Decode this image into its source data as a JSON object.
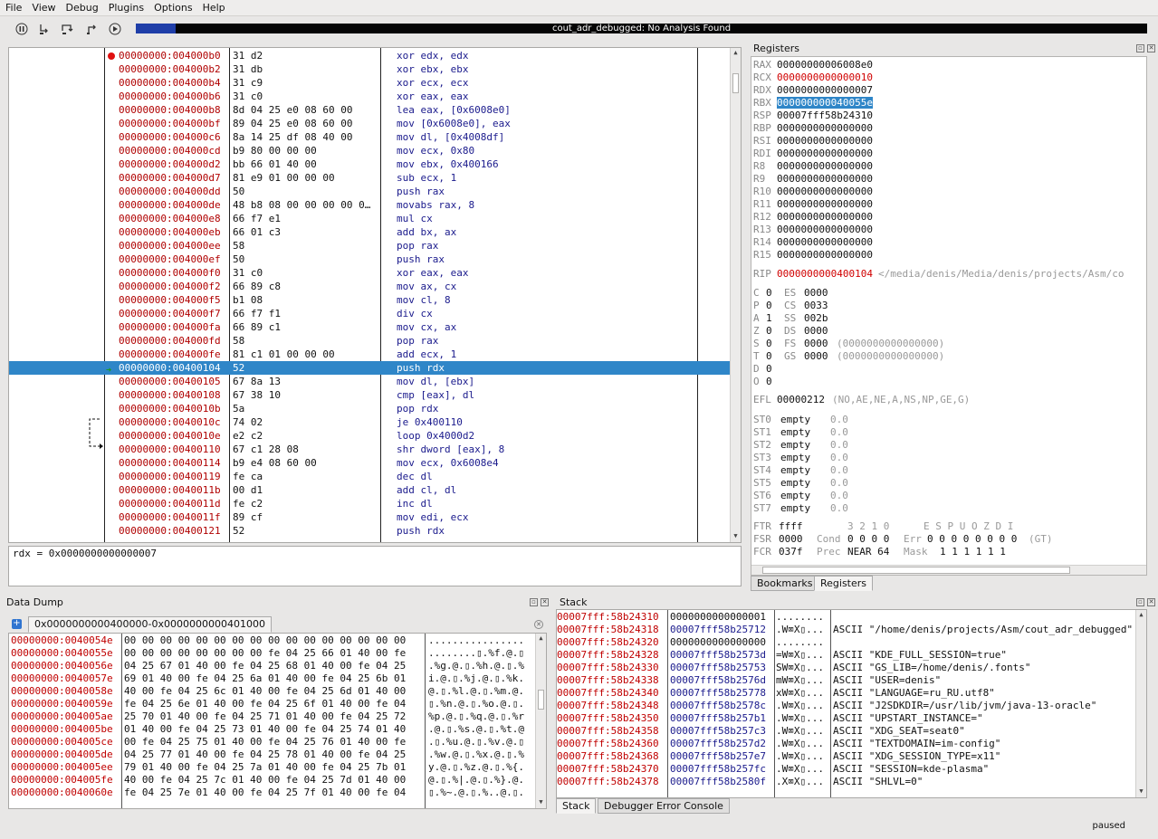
{
  "menubar": {
    "items": [
      "File",
      "View",
      "Debug",
      "Plugins",
      "Options",
      "Help"
    ]
  },
  "toolbar": {
    "buttons": [
      "pause-icon",
      "step-into-icon",
      "step-over-icon",
      "step-out-icon",
      "run-icon"
    ],
    "status_text": "cout_adr_debugged: No Analysis Found"
  },
  "cpu": {
    "rows": [
      {
        "addr": "00000000:004000b0",
        "bytes": "31 d2",
        "ins": "xor edx, edx",
        "bp": true
      },
      {
        "addr": "00000000:004000b2",
        "bytes": "31 db",
        "ins": "xor ebx, ebx"
      },
      {
        "addr": "00000000:004000b4",
        "bytes": "31 c9",
        "ins": "xor ecx, ecx"
      },
      {
        "addr": "00000000:004000b6",
        "bytes": "31 c0",
        "ins": "xor eax, eax"
      },
      {
        "addr": "00000000:004000b8",
        "bytes": "8d 04 25 e0 08 60 00",
        "ins": "lea eax, [0x6008e0]"
      },
      {
        "addr": "00000000:004000bf",
        "bytes": "89 04 25 e0 08 60 00",
        "ins": "mov [0x6008e0], eax"
      },
      {
        "addr": "00000000:004000c6",
        "bytes": "8a 14 25 df 08 40 00",
        "ins": "mov dl, [0x4008df]"
      },
      {
        "addr": "00000000:004000cd",
        "bytes": "b9 80 00 00 00",
        "ins": "mov ecx, 0x80"
      },
      {
        "addr": "00000000:004000d2",
        "bytes": "bb 66 01 40 00",
        "ins": "mov ebx, 0x400166"
      },
      {
        "addr": "00000000:004000d7",
        "bytes": "81 e9 01 00 00 00",
        "ins": "sub ecx, 1"
      },
      {
        "addr": "00000000:004000dd",
        "bytes": "50",
        "ins": "push rax"
      },
      {
        "addr": "00000000:004000de",
        "bytes": "48 b8 08 00 00 00 00 0…",
        "ins": "movabs rax, 8"
      },
      {
        "addr": "00000000:004000e8",
        "bytes": "66 f7 e1",
        "ins": "mul cx"
      },
      {
        "addr": "00000000:004000eb",
        "bytes": "66 01 c3",
        "ins": "add bx, ax"
      },
      {
        "addr": "00000000:004000ee",
        "bytes": "58",
        "ins": "pop rax"
      },
      {
        "addr": "00000000:004000ef",
        "bytes": "50",
        "ins": "push rax"
      },
      {
        "addr": "00000000:004000f0",
        "bytes": "31 c0",
        "ins": "xor eax, eax"
      },
      {
        "addr": "00000000:004000f2",
        "bytes": "66 89 c8",
        "ins": "mov ax, cx"
      },
      {
        "addr": "00000000:004000f5",
        "bytes": "b1 08",
        "ins": "mov cl, 8"
      },
      {
        "addr": "00000000:004000f7",
        "bytes": "66 f7 f1",
        "ins": "div cx"
      },
      {
        "addr": "00000000:004000fa",
        "bytes": "66 89 c1",
        "ins": "mov cx, ax"
      },
      {
        "addr": "00000000:004000fd",
        "bytes": "58",
        "ins": "pop rax"
      },
      {
        "addr": "00000000:004000fe",
        "bytes": "81 c1 01 00 00 00",
        "ins": "add ecx, 1"
      },
      {
        "addr": "00000000:00400104",
        "bytes": "52",
        "ins": "push rdx",
        "current": true
      },
      {
        "addr": "00000000:00400105",
        "bytes": "67 8a 13",
        "ins": "mov dl, [ebx]"
      },
      {
        "addr": "00000000:00400108",
        "bytes": "67 38 10",
        "ins": "cmp [eax], dl"
      },
      {
        "addr": "00000000:0040010b",
        "bytes": "5a",
        "ins": "pop rdx"
      },
      {
        "addr": "00000000:0040010c",
        "bytes": "74 02",
        "ins": "je 0x400110"
      },
      {
        "addr": "00000000:0040010e",
        "bytes": "e2 c2",
        "ins": "loop 0x4000d2"
      },
      {
        "addr": "00000000:00400110",
        "bytes": "67 c1 28 08",
        "ins": "shr dword [eax], 8"
      },
      {
        "addr": "00000000:00400114",
        "bytes": "b9 e4 08 60 00",
        "ins": "mov ecx, 0x6008e4"
      },
      {
        "addr": "00000000:00400119",
        "bytes": "fe ca",
        "ins": "dec dl"
      },
      {
        "addr": "00000000:0040011b",
        "bytes": "00 d1",
        "ins": "add cl, dl"
      },
      {
        "addr": "00000000:0040011d",
        "bytes": "fe c2",
        "ins": "inc dl"
      },
      {
        "addr": "00000000:0040011f",
        "bytes": "89 cf",
        "ins": "mov edi, ecx"
      },
      {
        "addr": "00000000:00400121",
        "bytes": "52",
        "ins": "push rdx"
      }
    ],
    "expression": "rdx = 0x0000000000000007"
  },
  "registers": {
    "title": "Registers",
    "gp": [
      {
        "n": "RAX",
        "v": "00000000006008e0"
      },
      {
        "n": "RCX",
        "v": "0000000000000010",
        "chg": true
      },
      {
        "n": "RDX",
        "v": "0000000000000007"
      },
      {
        "n": "RBX",
        "v": "000000000040055e",
        "hl": true
      },
      {
        "n": "RSP",
        "v": "00007fff58b24310"
      },
      {
        "n": "RBP",
        "v": "0000000000000000"
      },
      {
        "n": "RSI",
        "v": "0000000000000000"
      },
      {
        "n": "RDI",
        "v": "0000000000000000"
      },
      {
        "n": "R8",
        "v": "0000000000000000"
      },
      {
        "n": "R9",
        "v": "0000000000000000"
      },
      {
        "n": "R10",
        "v": "0000000000000000"
      },
      {
        "n": "R11",
        "v": "0000000000000000"
      },
      {
        "n": "R12",
        "v": "0000000000000000"
      },
      {
        "n": "R13",
        "v": "0000000000000000"
      },
      {
        "n": "R14",
        "v": "0000000000000000"
      },
      {
        "n": "R15",
        "v": "0000000000000000"
      }
    ],
    "rip": {
      "n": "RIP",
      "v": "0000000000400104",
      "c": "</media/denis/Media/denis/projects/Asm/co"
    },
    "flags": [
      {
        "f": "C",
        "fv": "0",
        "s": "ES",
        "sv": "0000",
        "c": ""
      },
      {
        "f": "P",
        "fv": "0",
        "s": "CS",
        "sv": "0033",
        "c": ""
      },
      {
        "f": "A",
        "fv": "1",
        "s": "SS",
        "sv": "002b",
        "c": ""
      },
      {
        "f": "Z",
        "fv": "0",
        "s": "DS",
        "sv": "0000",
        "c": ""
      },
      {
        "f": "S",
        "fv": "0",
        "s": "FS",
        "sv": "0000",
        "c": "(0000000000000000)"
      },
      {
        "f": "T",
        "fv": "0",
        "s": "GS",
        "sv": "0000",
        "c": "(0000000000000000)"
      },
      {
        "f": "D",
        "fv": "0",
        "s": "",
        "sv": "",
        "c": ""
      },
      {
        "f": "O",
        "fv": "0",
        "s": "",
        "sv": "",
        "c": ""
      }
    ],
    "efl": {
      "n": "EFL",
      "v": "00000212",
      "c": "(NO,AE,NE,A,NS,NP,GE,G)"
    },
    "fpu": [
      {
        "n": "ST0",
        "v": "empty",
        "c": "0.0"
      },
      {
        "n": "ST1",
        "v": "empty",
        "c": "0.0"
      },
      {
        "n": "ST2",
        "v": "empty",
        "c": "0.0"
      },
      {
        "n": "ST3",
        "v": "empty",
        "c": "0.0"
      },
      {
        "n": "ST4",
        "v": "empty",
        "c": "0.0"
      },
      {
        "n": "ST5",
        "v": "empty",
        "c": "0.0"
      },
      {
        "n": "ST6",
        "v": "empty",
        "c": "0.0"
      },
      {
        "n": "ST7",
        "v": "empty",
        "c": "0.0"
      }
    ],
    "ftr": {
      "n": "FTR",
      "v": "ffff",
      "h1": "3 2 1 0",
      "h2": "E S P U O Z D I"
    },
    "fsr": {
      "n": "FSR",
      "v": "0000",
      "l1": "Cond",
      "v1": "0 0 0 0",
      "l2": "Err",
      "v2": "0 0 0 0 0 0 0 0",
      "c": "(GT)"
    },
    "fcr": {
      "n": "FCR",
      "v": "037f",
      "l1": "Prec",
      "v1": "NEAR 64",
      "l2": "Mask",
      "v2": "1 1 1 1 1 1"
    },
    "tabs": [
      "Bookmarks",
      "Registers"
    ]
  },
  "datadump": {
    "title": "Data Dump",
    "tab": "0x0000000000400000-0x0000000000401000",
    "rows": [
      {
        "a": "00000000:0040054e",
        "h": "00 00 00 00 00 00 00 00 00 00 00 00 00 00 00 00",
        "s": "................"
      },
      {
        "a": "00000000:0040055e",
        "h": "00 00 00 00 00 00 00 00 fe 04 25 66 01 40 00 fe",
        "s": "........▯.%f.@.▯"
      },
      {
        "a": "00000000:0040056e",
        "h": "04 25 67 01 40 00 fe 04 25 68 01 40 00 fe 04 25",
        "s": ".%g.@.▯.%h.@.▯.%"
      },
      {
        "a": "00000000:0040057e",
        "h": "69 01 40 00 fe 04 25 6a 01 40 00 fe 04 25 6b 01",
        "s": "i.@.▯.%j.@.▯.%k."
      },
      {
        "a": "00000000:0040058e",
        "h": "40 00 fe 04 25 6c 01 40 00 fe 04 25 6d 01 40 00",
        "s": "@.▯.%l.@.▯.%m.@."
      },
      {
        "a": "00000000:0040059e",
        "h": "fe 04 25 6e 01 40 00 fe 04 25 6f 01 40 00 fe 04",
        "s": "▯.%n.@.▯.%o.@.▯."
      },
      {
        "a": "00000000:004005ae",
        "h": "25 70 01 40 00 fe 04 25 71 01 40 00 fe 04 25 72",
        "s": "%p.@.▯.%q.@.▯.%r"
      },
      {
        "a": "00000000:004005be",
        "h": "01 40 00 fe 04 25 73 01 40 00 fe 04 25 74 01 40",
        "s": ".@.▯.%s.@.▯.%t.@"
      },
      {
        "a": "00000000:004005ce",
        "h": "00 fe 04 25 75 01 40 00 fe 04 25 76 01 40 00 fe",
        "s": ".▯.%u.@.▯.%v.@.▯"
      },
      {
        "a": "00000000:004005de",
        "h": "04 25 77 01 40 00 fe 04 25 78 01 40 00 fe 04 25",
        "s": ".%w.@.▯.%x.@.▯.%"
      },
      {
        "a": "00000000:004005ee",
        "h": "79 01 40 00 fe 04 25 7a 01 40 00 fe 04 25 7b 01",
        "s": "y.@.▯.%z.@.▯.%{."
      },
      {
        "a": "00000000:004005fe",
        "h": "40 00 fe 04 25 7c 01 40 00 fe 04 25 7d 01 40 00",
        "s": "@.▯.%|.@.▯.%}.@."
      },
      {
        "a": "00000000:0040060e",
        "h": "fe 04 25 7e 01 40 00 fe 04 25 7f 01 40 00 fe 04",
        "s": "▯.%~.@.▯.%..@.▯."
      }
    ]
  },
  "stack": {
    "title": "Stack",
    "rows": [
      {
        "a": "00007fff:58b24310",
        "v": "0000000000000001",
        "as": "........",
        "c": "",
        "blu": false
      },
      {
        "a": "00007fff:58b24318",
        "v": "00007fff58b25712",
        "as": ".W⌧X▯...",
        "c": "ASCII \"/home/denis/projects/Asm/cout_adr_debugged\"",
        "blu": true
      },
      {
        "a": "00007fff:58b24320",
        "v": "0000000000000000",
        "as": "........",
        "c": "",
        "blu": false
      },
      {
        "a": "00007fff:58b24328",
        "v": "00007fff58b2573d",
        "as": "=W⌧X▯...",
        "c": "ASCII \"KDE_FULL_SESSION=true\"",
        "blu": true
      },
      {
        "a": "00007fff:58b24330",
        "v": "00007fff58b25753",
        "as": "SW⌧X▯...",
        "c": "ASCII \"GS_LIB=/home/denis/.fonts\"",
        "blu": true
      },
      {
        "a": "00007fff:58b24338",
        "v": "00007fff58b2576d",
        "as": "mW⌧X▯...",
        "c": "ASCII \"USER=denis\"",
        "blu": true
      },
      {
        "a": "00007fff:58b24340",
        "v": "00007fff58b25778",
        "as": "xW⌧X▯...",
        "c": "ASCII \"LANGUAGE=ru_RU.utf8\"",
        "blu": true
      },
      {
        "a": "00007fff:58b24348",
        "v": "00007fff58b2578c",
        "as": ".W⌧X▯...",
        "c": "ASCII \"J2SDKDIR=/usr/lib/jvm/java-13-oracle\"",
        "blu": true
      },
      {
        "a": "00007fff:58b24350",
        "v": "00007fff58b257b1",
        "as": ".W⌧X▯...",
        "c": "ASCII \"UPSTART_INSTANCE=\"",
        "blu": true
      },
      {
        "a": "00007fff:58b24358",
        "v": "00007fff58b257c3",
        "as": ".W⌧X▯...",
        "c": "ASCII \"XDG_SEAT=seat0\"",
        "blu": true
      },
      {
        "a": "00007fff:58b24360",
        "v": "00007fff58b257d2",
        "as": ".W⌧X▯...",
        "c": "ASCII \"TEXTDOMAIN=im-config\"",
        "blu": true
      },
      {
        "a": "00007fff:58b24368",
        "v": "00007fff58b257e7",
        "as": ".W⌧X▯...",
        "c": "ASCII \"XDG_SESSION_TYPE=x11\"",
        "blu": true
      },
      {
        "a": "00007fff:58b24370",
        "v": "00007fff58b257fc",
        "as": ".W⌧X▯...",
        "c": "ASCII \"SESSION=kde-plasma\"",
        "blu": true
      },
      {
        "a": "00007fff:58b24378",
        "v": "00007fff58b2580f",
        "as": ".X⌧X▯...",
        "c": "ASCII \"SHLVL=0\"",
        "blu": true
      }
    ],
    "tabs": [
      "Stack",
      "Debugger Error Console"
    ]
  },
  "status": "paused"
}
